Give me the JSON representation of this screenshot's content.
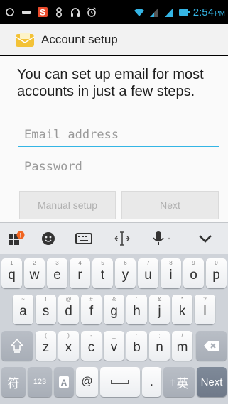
{
  "status_bar": {
    "time": "2:54",
    "ampm": "PM",
    "icons": [
      "circle-outline-icon",
      "minus-icon",
      "s-app-icon",
      "eight-icon",
      "headphones-icon",
      "alarm-icon",
      "wifi-icon",
      "signal-icon",
      "signal-icon",
      "battery-icon"
    ]
  },
  "action_bar": {
    "title": "Account setup",
    "icon": "email-app-icon"
  },
  "setup": {
    "intro": "You can set up email for most accounts in just a few steps.",
    "email_placeholder": "Email address",
    "email_value": "",
    "password_placeholder": "Password",
    "password_value": "",
    "manual_setup_label": "Manual setup",
    "next_label": "Next"
  },
  "keyboard": {
    "toolbar": [
      "apps-icon",
      "emoji-icon",
      "keyboard-icon",
      "cursor-move-icon",
      "microphone-icon",
      "collapse-icon"
    ],
    "row1": [
      {
        "k": "q",
        "s": "1"
      },
      {
        "k": "w",
        "s": "2"
      },
      {
        "k": "e",
        "s": "3"
      },
      {
        "k": "r",
        "s": "4"
      },
      {
        "k": "t",
        "s": "5"
      },
      {
        "k": "y",
        "s": "6"
      },
      {
        "k": "u",
        "s": "7"
      },
      {
        "k": "i",
        "s": "8"
      },
      {
        "k": "o",
        "s": "9"
      },
      {
        "k": "p",
        "s": "0"
      }
    ],
    "row2": [
      {
        "k": "a",
        "s": "~"
      },
      {
        "k": "s",
        "s": "!"
      },
      {
        "k": "d",
        "s": "@"
      },
      {
        "k": "f",
        "s": "#"
      },
      {
        "k": "g",
        "s": "%"
      },
      {
        "k": "h",
        "s": "'"
      },
      {
        "k": "j",
        "s": "&"
      },
      {
        "k": "k",
        "s": "*"
      },
      {
        "k": "l",
        "s": "?"
      }
    ],
    "row3": [
      {
        "k": "z",
        "s": "("
      },
      {
        "k": "x",
        "s": ")"
      },
      {
        "k": "c",
        "s": "-"
      },
      {
        "k": "v",
        "s": "_"
      },
      {
        "k": "b",
        "s": ":"
      },
      {
        "k": "n",
        "s": ";"
      },
      {
        "k": "m",
        "s": "/"
      }
    ],
    "bottom": {
      "symbols": "符",
      "numbers": "123",
      "at": "@",
      "period": ".",
      "lang_primary": "英",
      "lang_secondary": "中",
      "next": "Next"
    }
  }
}
